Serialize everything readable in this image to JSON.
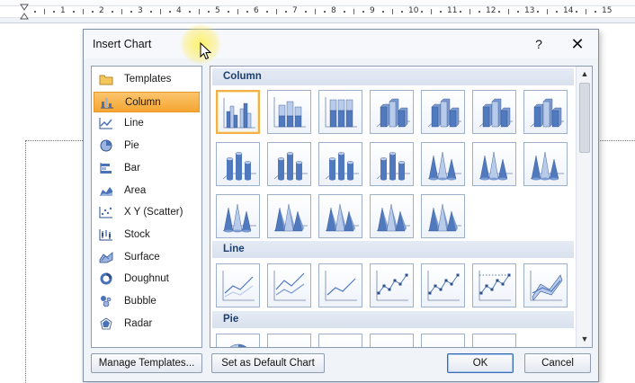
{
  "ruler": {
    "numbers": [
      "1",
      "2",
      "3",
      "4",
      "5",
      "6",
      "7",
      "8",
      "9",
      "10",
      "11",
      "12",
      "13",
      "14",
      "15"
    ]
  },
  "dialog": {
    "title": "Insert Chart",
    "help_label": "?",
    "close_label": "✕"
  },
  "chart_types": [
    {
      "label": "Templates",
      "icon": "folder-icon"
    },
    {
      "label": "Column",
      "icon": "column-chart-icon",
      "selected": true
    },
    {
      "label": "Line",
      "icon": "line-chart-icon"
    },
    {
      "label": "Pie",
      "icon": "pie-chart-icon"
    },
    {
      "label": "Bar",
      "icon": "bar-chart-icon"
    },
    {
      "label": "Area",
      "icon": "area-chart-icon"
    },
    {
      "label": "X Y (Scatter)",
      "icon": "scatter-chart-icon"
    },
    {
      "label": "Stock",
      "icon": "stock-chart-icon"
    },
    {
      "label": "Surface",
      "icon": "surface-chart-icon"
    },
    {
      "label": "Doughnut",
      "icon": "doughnut-chart-icon"
    },
    {
      "label": "Bubble",
      "icon": "bubble-chart-icon"
    },
    {
      "label": "Radar",
      "icon": "radar-chart-icon"
    }
  ],
  "gallery": {
    "sections": [
      {
        "title": "Column"
      },
      {
        "title": "Line"
      },
      {
        "title": "Pie"
      }
    ]
  },
  "buttons": {
    "manage_templates": "Manage Templates...",
    "set_default": "Set as Default Chart",
    "ok": "OK",
    "cancel": "Cancel"
  },
  "colors": {
    "selection_orange": "#f5a531",
    "chart_blue": "#4a72b8",
    "section_text": "#1c3f73"
  }
}
